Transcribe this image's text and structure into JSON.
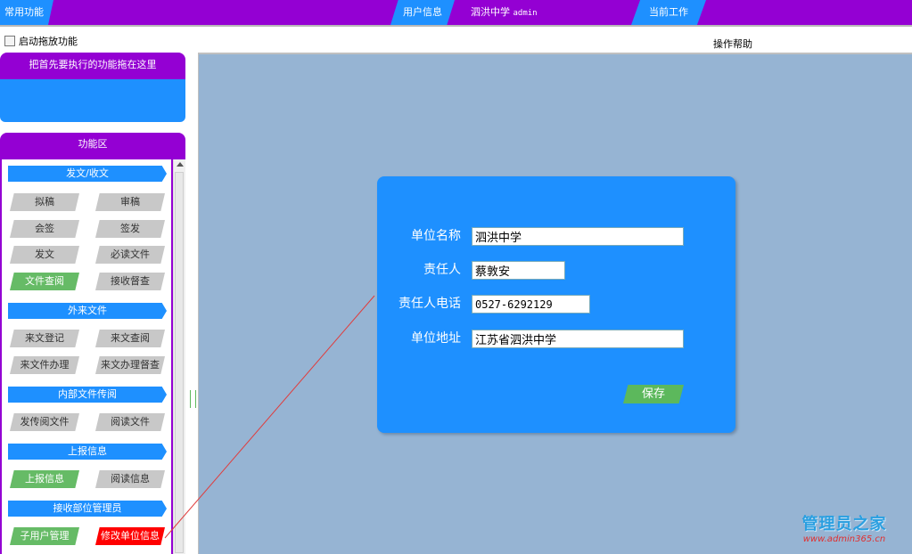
{
  "topbar": {
    "common_functions": "常用功能",
    "user_info": "用户信息",
    "school_name": "泗洪中学",
    "username": "admin",
    "current_work": "当前工作"
  },
  "drag_toggle_label": "启动拖放功能",
  "help_title": "操作帮助",
  "quick_panel": {
    "title": "把首先要执行的功能拖在这里"
  },
  "func_panel": {
    "title": "功能区",
    "groups": [
      {
        "title": "发文/收文",
        "items": [
          "拟稿",
          "审稿",
          "会签",
          "签发",
          "发文",
          "必读文件",
          "文件查阅",
          "接收督查"
        ]
      },
      {
        "title": "外来文件",
        "items": [
          "来文登记",
          "来文查阅",
          "来文件办理",
          "来文办理督查"
        ]
      },
      {
        "title": "内部文件传阅",
        "items": [
          "发传阅文件",
          "阅读文件"
        ]
      },
      {
        "title": "上报信息",
        "items": [
          "上报信息",
          "阅读信息"
        ]
      },
      {
        "title": "接收部位管理员",
        "items": [
          "子用户管理",
          "修改单位信息"
        ]
      }
    ]
  },
  "form": {
    "unit_name_label": "单位名称",
    "unit_name": "泗洪中学",
    "person_label": "责任人",
    "person": "蔡敦安",
    "phone_label": "责任人电话",
    "phone": "0527-6292129",
    "address_label": "单位地址",
    "address": "江苏省泗洪中学",
    "save": "保存"
  },
  "watermark": {
    "name": "管理员之家",
    "url": "www.admin365.cn"
  },
  "colors": {
    "purple": "#9400d3",
    "blue": "#1e90ff",
    "green": "#66bb66",
    "red": "#ff0000",
    "content_bg": "#96b4d3"
  }
}
